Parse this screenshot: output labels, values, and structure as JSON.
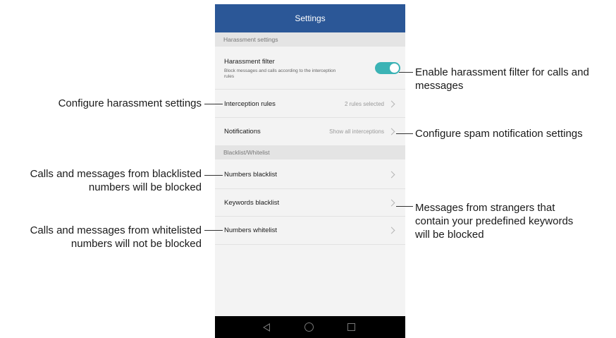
{
  "screen": {
    "title": "Settings",
    "sections": [
      {
        "header": "Harassment settings"
      },
      {
        "header": "Blacklist/Whitelist"
      }
    ],
    "harassment_filter": {
      "label": "Harassment filter",
      "description": "Block messages and calls according to the interception rules",
      "enabled": true
    },
    "interception_rules": {
      "label": "Interception rules",
      "value": "2 rules selected"
    },
    "notifications": {
      "label": "Notifications",
      "value": "Show all interceptions"
    },
    "numbers_blacklist": {
      "label": "Numbers blacklist"
    },
    "keywords_blacklist": {
      "label": "Keywords blacklist"
    },
    "numbers_whitelist": {
      "label": "Numbers whitelist"
    },
    "nav_icons": [
      "back-icon",
      "home-icon",
      "recent-apps-icon"
    ],
    "colors": {
      "title_bar": "#2b5797",
      "toggle_on": "#3bb3b5",
      "background": "#f3f3f3"
    }
  },
  "annotations": {
    "harassment_filter": "Enable harassment filter for calls and messages",
    "interception_rules": "Configure harassment settings",
    "notifications": "Configure spam notification settings",
    "numbers_blacklist": "Calls and messages from blacklisted numbers will be blocked",
    "keywords_blacklist": "Messages from strangers that contain your predefined keywords will be blocked",
    "numbers_whitelist": "Calls and messages from whitelisted numbers will not be blocked"
  }
}
